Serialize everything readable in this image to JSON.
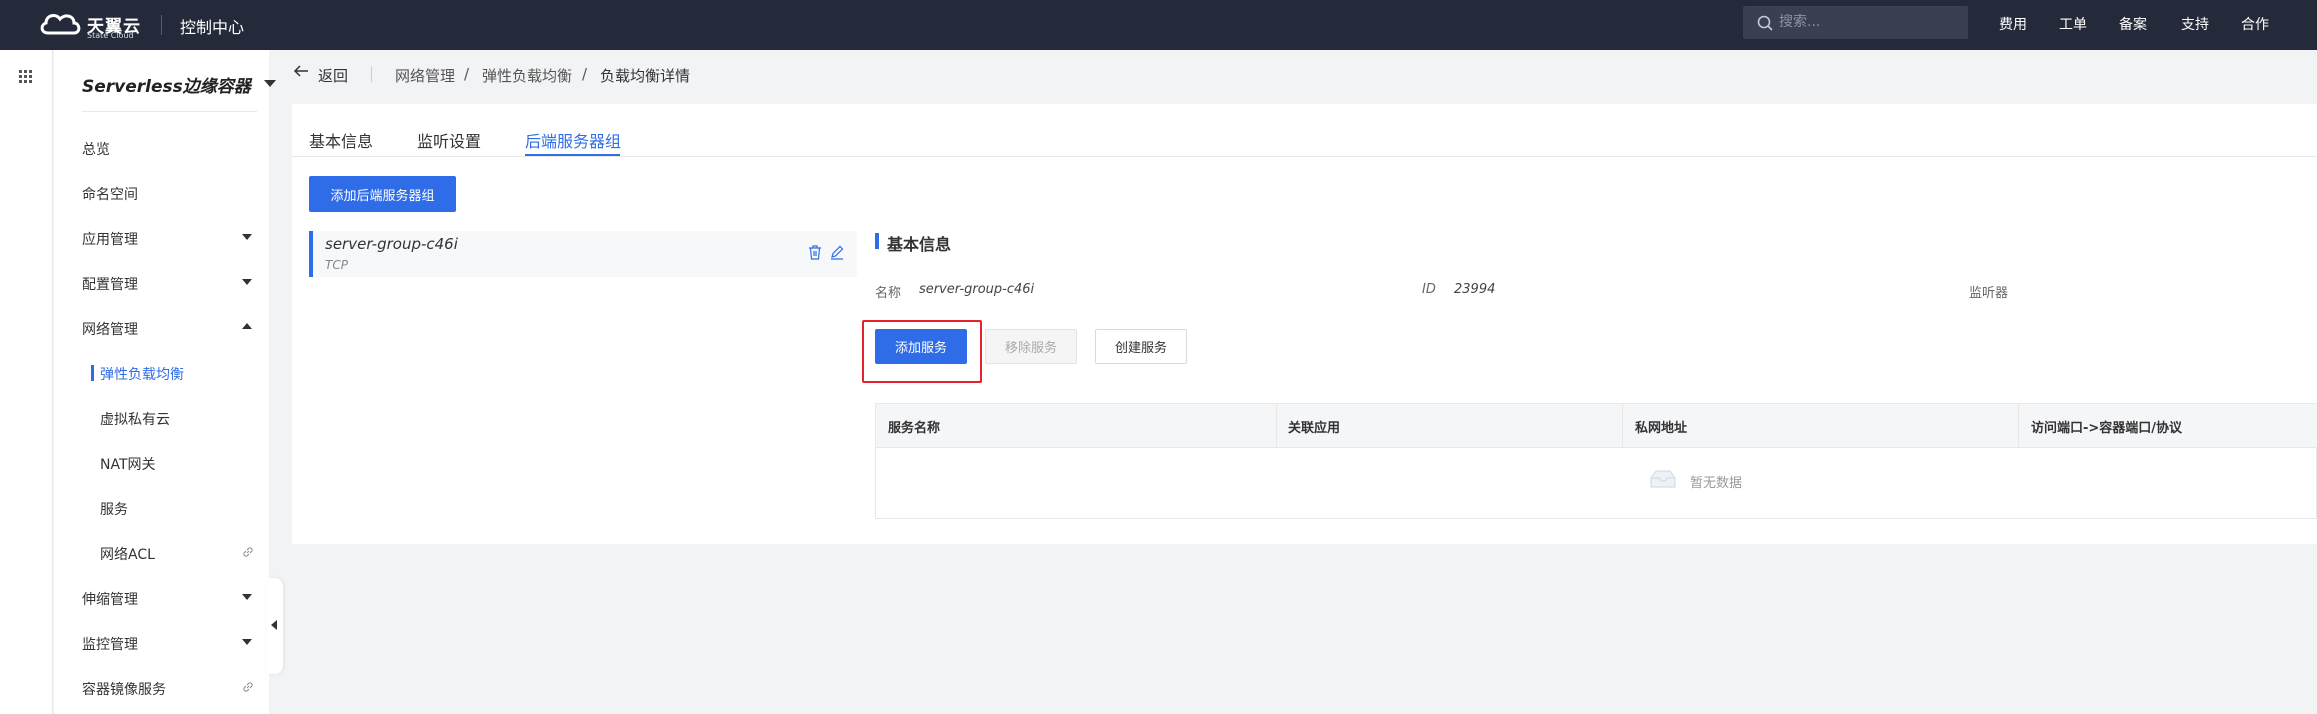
{
  "topbar": {
    "brand_cn": "天翼云",
    "brand_en": "State Cloud",
    "title": "控制中心",
    "search_placeholder": "搜索...",
    "nav": [
      "费用",
      "工单",
      "备案",
      "支持",
      "合作"
    ]
  },
  "sidebar": {
    "product": "Serverless边缘容器",
    "items": [
      {
        "label": "总览"
      },
      {
        "label": "命名空间"
      },
      {
        "label": "应用管理"
      },
      {
        "label": "配置管理"
      },
      {
        "label": "网络管理"
      },
      {
        "label": "弹性负载均衡"
      },
      {
        "label": "虚拟私有云"
      },
      {
        "label": "NAT网关"
      },
      {
        "label": "服务"
      },
      {
        "label": "网络ACL"
      },
      {
        "label": "伸缩管理"
      },
      {
        "label": "监控管理"
      },
      {
        "label": "容器镜像服务"
      }
    ]
  },
  "breadcrumb": {
    "back": "返回",
    "items": [
      "网络管理",
      "弹性负载均衡",
      "负载均衡详情"
    ],
    "separator": "/"
  },
  "tabs": [
    "基本信息",
    "监听设置",
    "后端服务器组"
  ],
  "actions": {
    "add_group": "添加后端服务器组"
  },
  "group": {
    "name": "server-group-c46i",
    "protocol": "TCP"
  },
  "detail": {
    "section_title": "基本信息",
    "name_label": "名称",
    "name_value": "server-group-c46i",
    "id_label": "ID",
    "id_value": "23994",
    "listener_label": "监听器",
    "buttons": {
      "add": "添加服务",
      "remove": "移除服务",
      "create": "创建服务"
    },
    "table": {
      "columns": [
        "服务名称",
        "关联应用",
        "私网地址",
        "访问端口->容器端口/协议"
      ],
      "empty_text": "暂无数据"
    }
  },
  "colors": {
    "topbar_bg": "#252a3a",
    "accent": "#2f6de8",
    "highlight": "#e8202a"
  }
}
